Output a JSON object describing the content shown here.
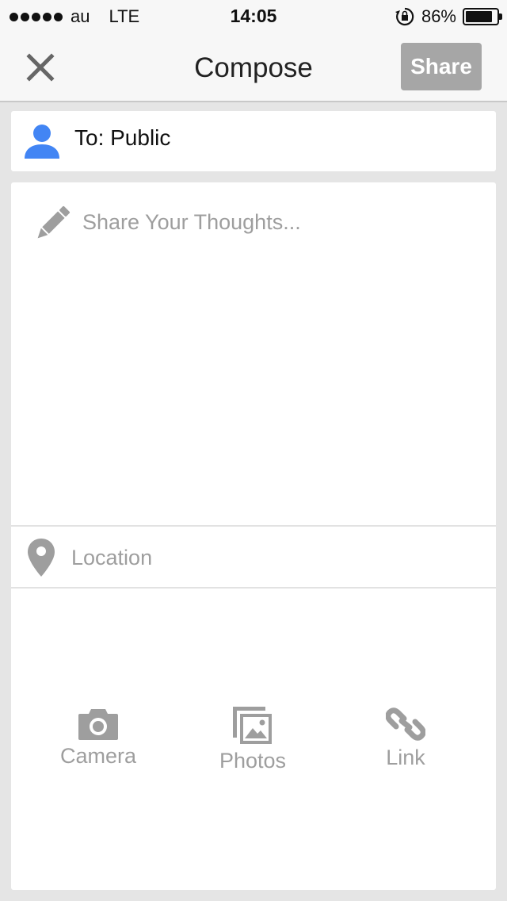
{
  "status_bar": {
    "carrier": "au",
    "network": "LTE",
    "time": "14:05",
    "battery_percent": "86%",
    "battery_level": 0.86
  },
  "nav": {
    "title": "Compose",
    "share_label": "Share"
  },
  "audience": {
    "label": "To: Public"
  },
  "composer": {
    "placeholder": "Share Your Thoughts..."
  },
  "location": {
    "label": "Location"
  },
  "attachments": [
    {
      "label": "Camera",
      "icon": "camera-icon"
    },
    {
      "label": "Photos",
      "icon": "photos-icon"
    },
    {
      "label": "Link",
      "icon": "link-icon"
    }
  ],
  "colors": {
    "accent_blue": "#4285f4",
    "icon_gray": "#9e9e9e",
    "share_button_bg": "#a6a6a6"
  }
}
